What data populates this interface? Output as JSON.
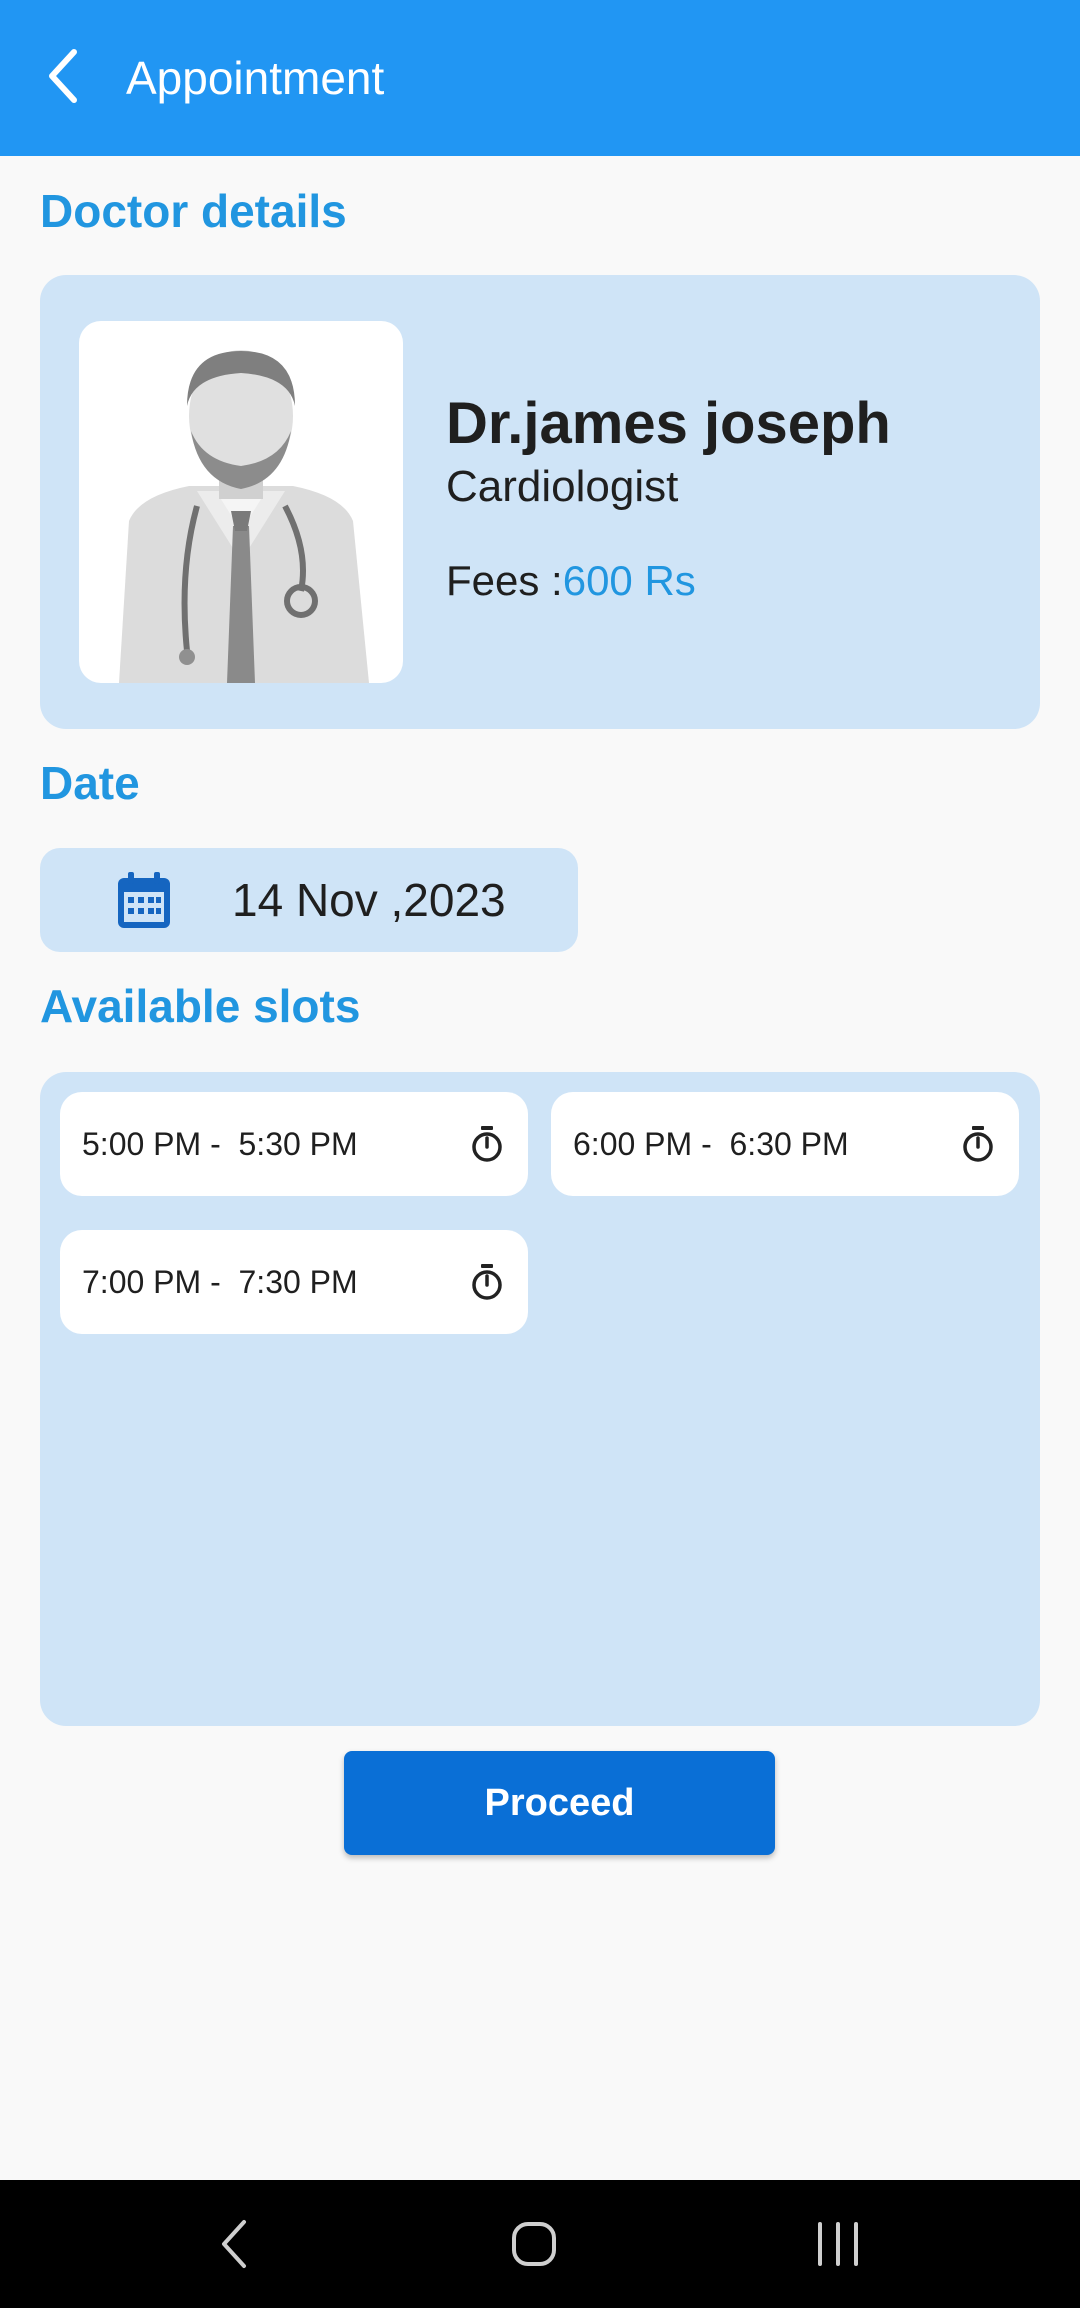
{
  "header": {
    "title": "Appointment",
    "back_icon": "chevron-left-icon"
  },
  "doctor_section": {
    "title": "Doctor details",
    "doctor": {
      "name": "Dr.james joseph",
      "specialty": "Cardiologist",
      "fees_label": "Fees :",
      "fees_value": "600 Rs",
      "photo_icon": "doctor-avatar"
    }
  },
  "date_section": {
    "title": "Date",
    "date": "14 Nov ,2023",
    "icon": "calendar-icon"
  },
  "slots_section": {
    "title": "Available slots",
    "slot_icon": "stopwatch-icon",
    "slots": [
      {
        "label": "5:00 PM -  5:30 PM"
      },
      {
        "label": "6:00 PM -  6:30 PM"
      },
      {
        "label": "7:00 PM -  7:30 PM"
      }
    ]
  },
  "proceed_label": "Proceed",
  "colors": {
    "app_bar": "#2196f3",
    "accent_text": "#2196e0",
    "card_background": "#cfe4f7",
    "primary_button": "#0a6fd6"
  },
  "system_nav": {
    "back_icon": "nav-back-icon",
    "home_icon": "nav-home-icon",
    "recents_icon": "nav-recents-icon"
  }
}
